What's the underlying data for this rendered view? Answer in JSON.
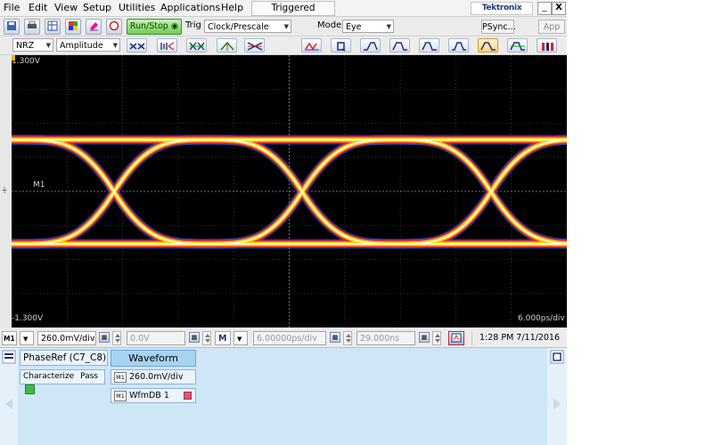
{
  "menu": {
    "items": [
      "File",
      "Edit",
      "View",
      "Setup",
      "Utilities",
      "Applications",
      "Help"
    ],
    "trigger_status": "Triggered",
    "brand": "Tektronix",
    "window_buttons": [
      "_",
      "X"
    ]
  },
  "toolbar1": {
    "run_stop_label": "Run/Stop",
    "trig_label": "Trig",
    "trig_source": "Clock/Prescale",
    "mode_label": "Mode",
    "mode_value": "Eye",
    "psync_label": "PSync...",
    "app_label": "App",
    "icons": [
      "save-icon",
      "print-icon",
      "table-icon",
      "grid-color-icon",
      "erase-icon"
    ]
  },
  "toolbar2": {
    "signal_type": "NRZ",
    "measurement": "Amplitude",
    "waveform_buttons": [
      "crossing-icon",
      "eye-height-icon",
      "eye-width-icon",
      "jitter-icon",
      "crossing-x-icon",
      "autoset-icon",
      "q-factor-icon",
      "rise-icon",
      "fall-icon",
      "overshoot-icon",
      "pulse-icon",
      "wave-a-icon",
      "wave-b-icon",
      "bars-icon"
    ]
  },
  "display": {
    "top_voltage": "1.300V",
    "bottom_voltage": "-1.300V",
    "marker_label": "M1",
    "timebase_label": "6.000ps/div",
    "colors": {
      "background": "#000000",
      "grid": "#5a5a5a",
      "trace_hot": "#ffffff",
      "trace_mid": "#ffd400",
      "trace_low": "#ff2a2a",
      "trace_cold": "#3a5cff"
    }
  },
  "controls": {
    "channel": "M1",
    "vertical_scale": "260.0mV/div",
    "offset": "0.0V",
    "timebase_channel": "M",
    "horizontal_scale": "6.00000ps/div",
    "position": "29.000ns",
    "datetime": "1:28 PM 7/11/2016"
  },
  "panel": {
    "phase_ref": "PhaseRef (C7_C8)",
    "waveform_tab": "Waveform",
    "characterize_label": "Characterize",
    "pass_label": "Pass",
    "scale_item": "260.0mV/div",
    "wfmdb_item": "WfmDB 1",
    "item_tag": "M1"
  }
}
